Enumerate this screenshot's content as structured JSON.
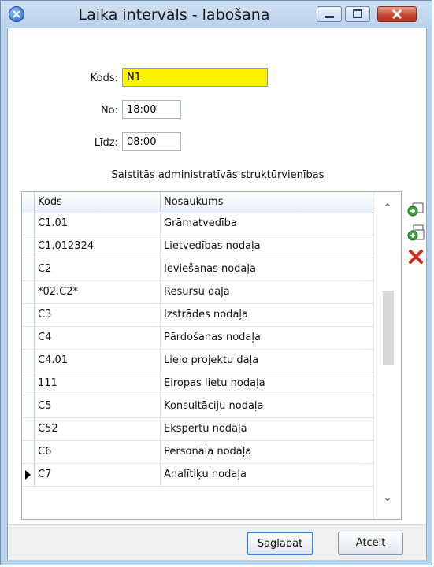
{
  "window": {
    "title": "Laika intervāls - labošana",
    "icon": "app-globe-icon"
  },
  "form": {
    "kods_label": "Kods:",
    "kods_value": "N1",
    "no_label": "No:",
    "no_value": "18:00",
    "lidz_label": "Līdz:",
    "lidz_value": "08:00"
  },
  "section_title": "Saistitās administratīvās struktūrvienības",
  "grid": {
    "columns": [
      "Kods",
      "Nosaukums"
    ],
    "rows": [
      {
        "kods": "C1.01",
        "nosaukums": "Grāmatvedība"
      },
      {
        "kods": "C1.012324",
        "nosaukums": "Lietvedības nodaļa"
      },
      {
        "kods": "C2",
        "nosaukums": "Ieviešanas nodaļa"
      },
      {
        "kods": "*02.C2*",
        "nosaukums": "Resursu daļa"
      },
      {
        "kods": "C3",
        "nosaukums": "Izstrādes nodaļa"
      },
      {
        "kods": "C4",
        "nosaukums": "Pārdošanas nodaļa"
      },
      {
        "kods": "C4.01",
        "nosaukums": "Lielo projektu daļa"
      },
      {
        "kods": "111",
        "nosaukums": "Eiropas lietu nodaļa"
      },
      {
        "kods": "C5",
        "nosaukums": "Konsultāciju nodaļa"
      },
      {
        "kods": "C52",
        "nosaukums": "Ekspertu nodaļa"
      },
      {
        "kods": "C6",
        "nosaukums": "Personāla nodaļa"
      },
      {
        "kods": "C7",
        "nosaukums": "Analītiķu nodaļa"
      }
    ],
    "current_row_index": 11
  },
  "tools": [
    "add-icon",
    "add-copy-icon",
    "delete-icon"
  ],
  "buttons": {
    "save": "Saglabāt",
    "cancel": "Atcelt"
  }
}
